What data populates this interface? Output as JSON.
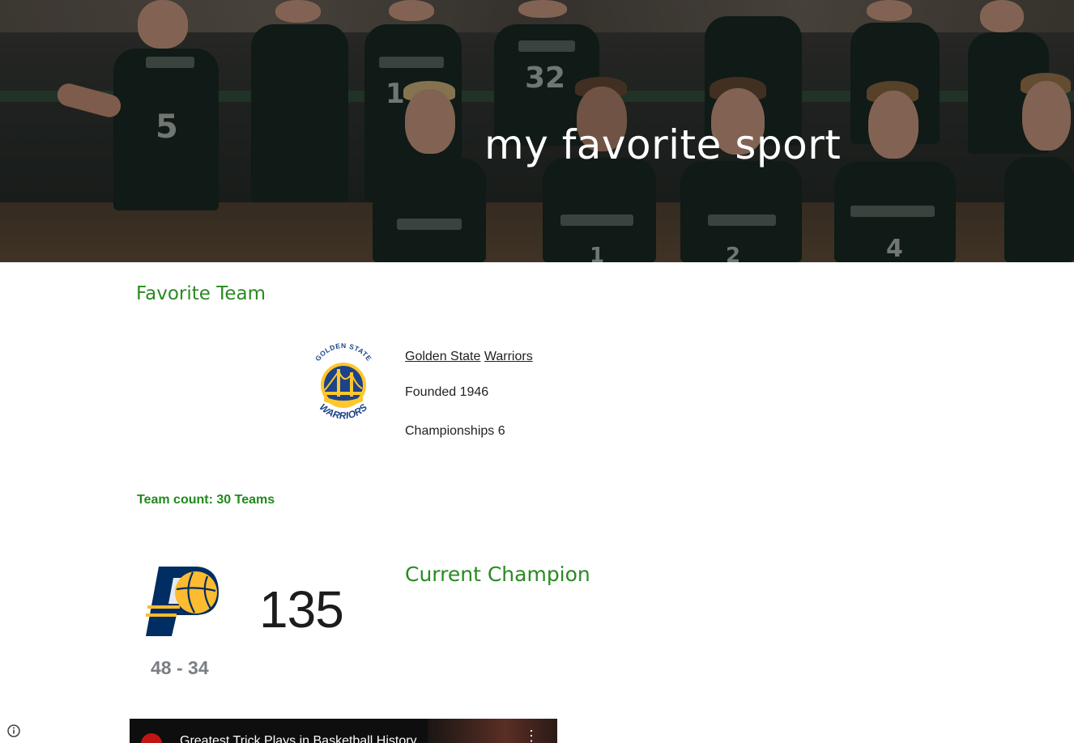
{
  "hero": {
    "title": "my favorite sport",
    "jersey_numbers": [
      "5",
      "14",
      "32",
      "1",
      "2",
      "4"
    ]
  },
  "favorite_team": {
    "heading": "Favorite Team",
    "name_part1": "Golden State",
    "name_part2": "Warriors",
    "founded": "Founded 1946",
    "championships": "Championships 6",
    "logo_text_top": "GOLDEN STATE",
    "logo_text_bottom": "WARRIORS",
    "colors": {
      "blue": "#1D428A",
      "gold": "#FFC72C"
    }
  },
  "team_count": "Team count: 30 Teams",
  "current_champion": {
    "heading": "Current Champion",
    "score": "135",
    "record": "48 - 34",
    "colors": {
      "navy": "#002D62",
      "gold": "#FDBB30"
    }
  },
  "video": {
    "title": "Greatest Trick Plays in Basketball History"
  },
  "colors": {
    "accent_green": "#2a8a22"
  },
  "icons": {
    "footer": "info-icon",
    "video_menu": "more-vert-icon"
  }
}
